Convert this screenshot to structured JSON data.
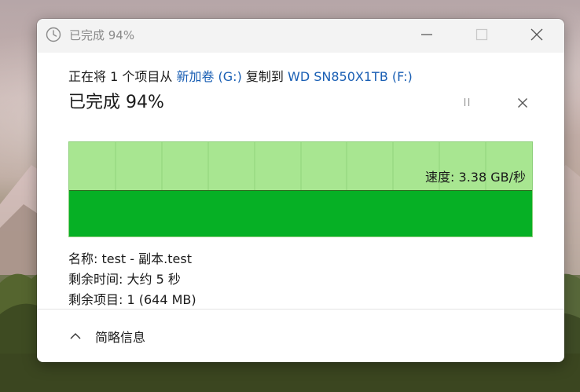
{
  "window": {
    "title": "已完成 94%"
  },
  "copy": {
    "prefix": "正在将 1 个项目从 ",
    "source": "新加卷 (G:)",
    "middle": " 复制到 ",
    "destination": "WD SN850X1TB (F:)"
  },
  "progress": {
    "heading": "已完成 94%",
    "percent": 94,
    "speed_text": "速度: 3.38 GB/秒"
  },
  "details": {
    "name": "名称:  test - 副本.test",
    "time_remaining": "剩余时间:  大约 5 秒",
    "items_remaining": "剩余项目:  1 (644 MB)"
  },
  "footer": {
    "toggle_label": "简略信息"
  },
  "colors": {
    "graph_background": "#a8e691",
    "graph_fill": "#06b025",
    "link": "#1a5fb4"
  },
  "icons": {
    "title": "clock-icon",
    "minimize": "minimize-icon",
    "maximize": "maximize-icon",
    "close": "close-icon",
    "pause": "pause-icon",
    "cancel": "cancel-icon",
    "toggle": "chevron-up-icon"
  }
}
